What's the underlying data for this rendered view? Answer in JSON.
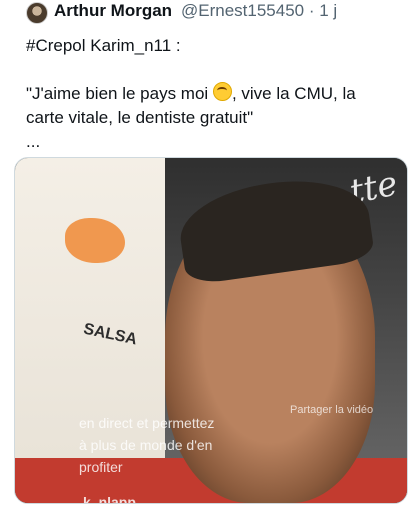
{
  "tweet": {
    "author_name": "Arthur Morgan",
    "handle_time": "@Ernest155450 · 1 j",
    "lines": [
      "#Crepol Karim_n11 :",
      "",
      "\"J'aime bien le pays moi",
      ", vive la CMU, la",
      "carte vitale, le dentiste gratuit\"",
      "..."
    ]
  },
  "media": {
    "poster_text": "SALSA",
    "wall_text": "tte",
    "overlay_line1": "en direct et permettez",
    "overlay_line2": "à plus de monde d'en",
    "overlay_line3": "profiter",
    "share_text": "Partager la vidéo",
    "user_tag": "k_nlapp"
  }
}
